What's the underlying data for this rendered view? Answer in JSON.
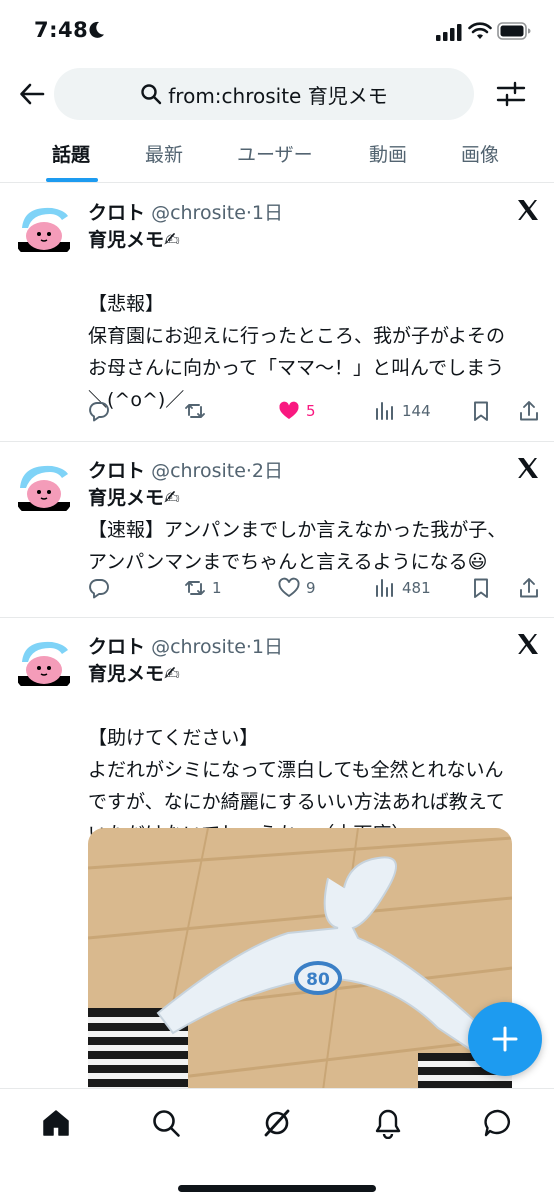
{
  "status_bar": {
    "time": "7:48"
  },
  "header": {
    "search_query": "from:chrosite 育児メモ"
  },
  "tabs": [
    {
      "label": "話題",
      "active": true
    },
    {
      "label": "最新",
      "active": false
    },
    {
      "label": "ユーザー",
      "active": false
    },
    {
      "label": "動画",
      "active": false
    },
    {
      "label": "画像",
      "active": false
    }
  ],
  "tweets": [
    {
      "name": "クロト",
      "meta": "@chrosite·1日",
      "lines": [
        "育児メモ✍",
        "",
        "【悲報】",
        "保育園にお迎えに行ったところ、我が子がよその",
        "お母さんに向かって「ママ〜！」と叫んでしまう",
        "＼(^o^)／"
      ],
      "replies": "",
      "retweets": "",
      "likes": "5",
      "liked": true,
      "views": "144"
    },
    {
      "name": "クロト",
      "meta": "@chrosite·2日",
      "lines": [
        "育児メモ✍",
        "【速報】アンパンまでしか言えなかった我が子、",
        "アンパンマンまでちゃんと言えるようになる😃"
      ],
      "replies": "",
      "retweets": "1",
      "likes": "9",
      "liked": false,
      "views": "481"
    },
    {
      "name": "クロト",
      "meta": "@chrosite·1日",
      "lines": [
        "育児メモ✍",
        "",
        "【助けてください】",
        "よだれがシミになって漂白しても全然とれないん",
        "ですが、なにか綺麗にするいい方法あれば教えて",
        "いただけないでしょうか…（土下座）"
      ],
      "media_label": "80"
    }
  ],
  "colors": {
    "accent": "#1d9bf0",
    "like": "#f91880",
    "text": "#0f1419",
    "muted": "#536471"
  },
  "icons": [
    "back-arrow-icon",
    "search-icon",
    "filter-icon",
    "x-logo-icon",
    "reply-icon",
    "retweet-icon",
    "heart-icon",
    "views-icon",
    "bookmark-icon",
    "share-icon",
    "plus-icon",
    "home-icon",
    "grok-icon",
    "bell-icon",
    "messages-icon"
  ]
}
